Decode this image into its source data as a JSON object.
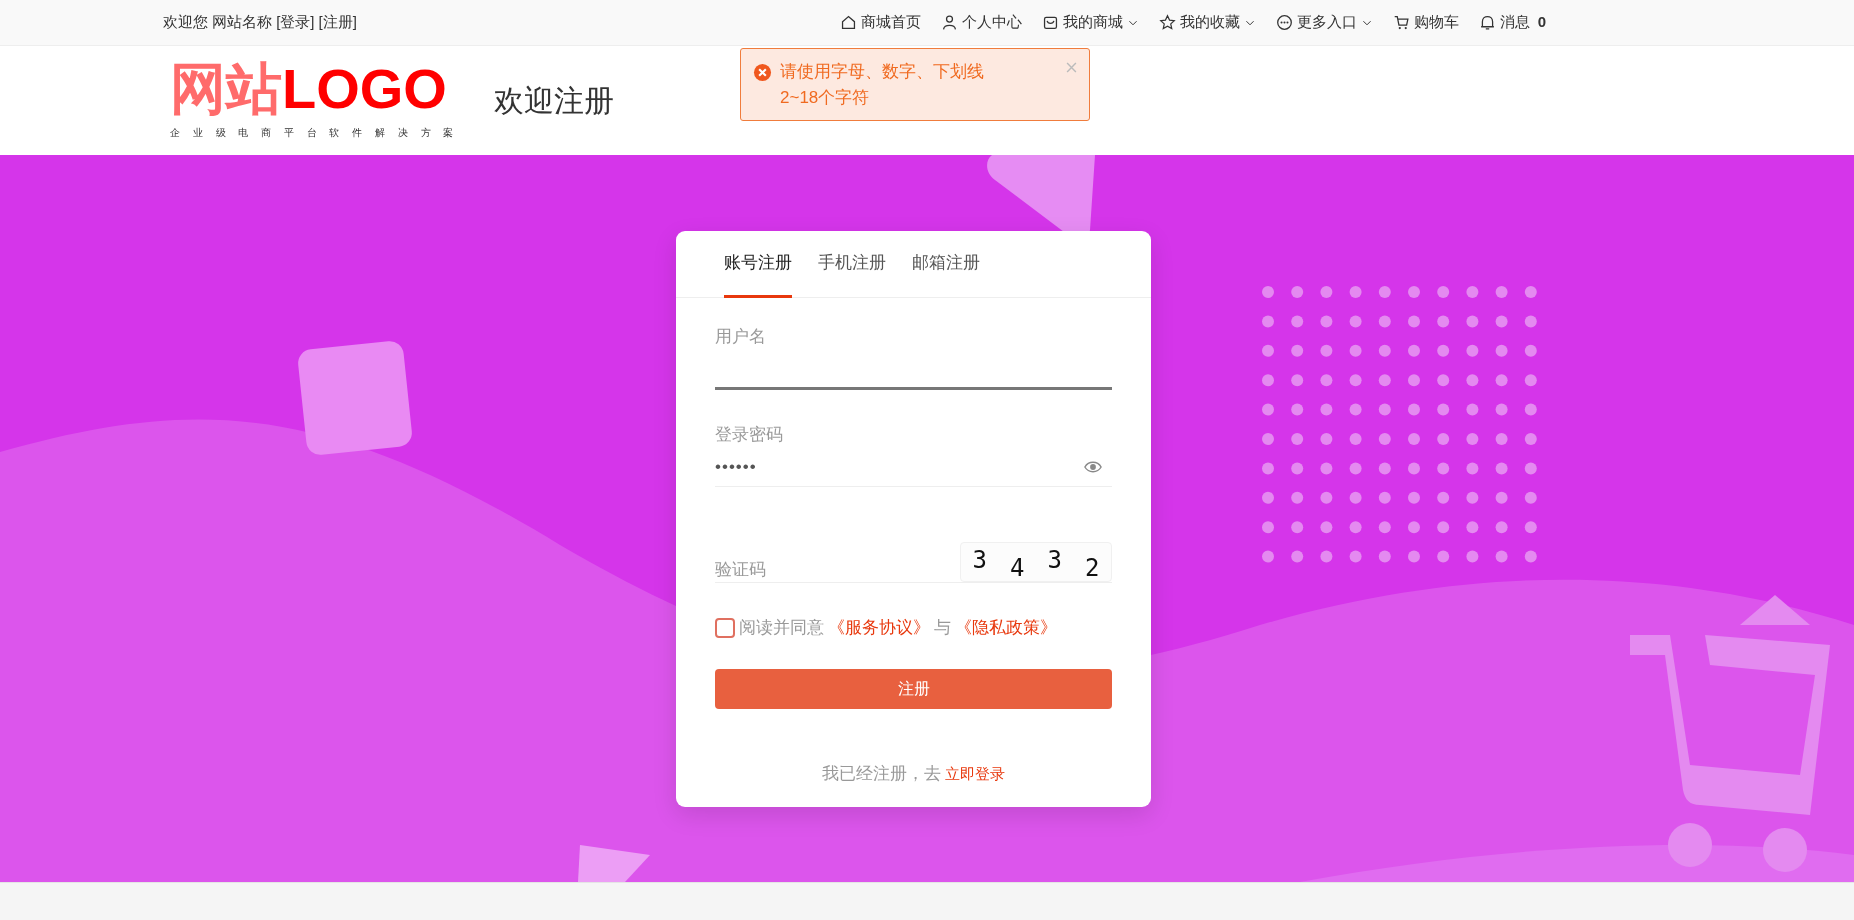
{
  "topbar": {
    "greeting": "欢迎您 网站名称",
    "login_link": "[登录]",
    "register_link": "[注册]",
    "nav": [
      {
        "label": "商城首页",
        "caret": false
      },
      {
        "label": "个人中心",
        "caret": false
      },
      {
        "label": "我的商城",
        "caret": true
      },
      {
        "label": "我的收藏",
        "caret": true
      },
      {
        "label": "更多入口",
        "caret": true
      },
      {
        "label": "购物车",
        "caret": false
      },
      {
        "label": "消息",
        "caret": false,
        "count": "0"
      }
    ]
  },
  "toast": {
    "message": "请使用字母、数字、下划线2~18个字符"
  },
  "header": {
    "logo_cn": "网站",
    "logo_en": "LOGO",
    "slogan": "企 业 级 电 商 平 台 软 件 解 决 方 案",
    "title": "欢迎注册"
  },
  "form": {
    "tabs": [
      {
        "label": "账号注册",
        "selected": true
      },
      {
        "label": "手机注册",
        "selected": false
      },
      {
        "label": "邮箱注册",
        "selected": false
      }
    ],
    "fields": [
      {
        "kind": "text",
        "label": "用户名",
        "focused": true
      },
      {
        "kind": "password",
        "label": "登录密码",
        "value": "••••••",
        "focused": false
      },
      {
        "kind": "captcha",
        "label": "验证码",
        "captcha": [
          "3",
          "4",
          "3",
          "2"
        ],
        "focused": false
      }
    ],
    "agree": {
      "checked": false,
      "text": "阅读并同意",
      "link1": "《服务协议》",
      "between": "与",
      "link2": "《隐私政策》"
    },
    "submit": "注册",
    "footer": {
      "text": "我已经注册，去",
      "link": "立即登录"
    }
  }
}
